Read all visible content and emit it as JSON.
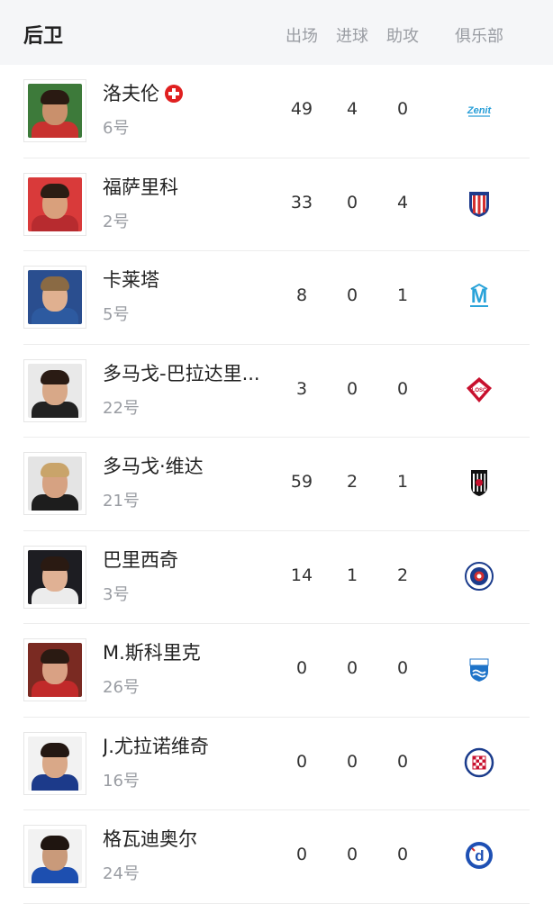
{
  "header": {
    "title": "后卫",
    "col_apps": "出场",
    "col_goals": "进球",
    "col_assists": "助攻",
    "col_club": "俱乐部"
  },
  "players": [
    {
      "name": "洛夫伦",
      "number": "6号",
      "apps": "49",
      "goals": "4",
      "assists": "0",
      "club_icon": "zenit-logo",
      "flag": "switzerland-flag-icon",
      "bg": "#3d7a3a",
      "skin": "#c9906c",
      "hair": "#2a1a12",
      "shirt": "#c8322f"
    },
    {
      "name": "福萨里科",
      "number": "2号",
      "apps": "33",
      "goals": "0",
      "assists": "4",
      "club_icon": "atletico-madrid-logo",
      "bg": "#d93a3a",
      "skin": "#d9a07c",
      "hair": "#2b1d14",
      "shirt": "#b72b2f"
    },
    {
      "name": "卡莱塔",
      "number": "5号",
      "apps": "8",
      "goals": "0",
      "assists": "1",
      "club_icon": "marseille-logo",
      "bg": "#2a4e8f",
      "skin": "#e0b090",
      "hair": "#8a6a44",
      "shirt": "#2d5aa0"
    },
    {
      "name": "多马戈-巴拉达里...",
      "number": "22号",
      "apps": "3",
      "goals": "0",
      "assists": "0",
      "club_icon": "lille-logo",
      "bg": "#e9e9e9",
      "skin": "#d8a888",
      "hair": "#2a1b14",
      "shirt": "#222222"
    },
    {
      "name": "多马戈·维达",
      "number": "21号",
      "apps": "59",
      "goals": "2",
      "assists": "1",
      "club_icon": "besiktas-logo",
      "bg": "#e4e4e4",
      "skin": "#d6a282",
      "hair": "#c9a46a",
      "shirt": "#1d1d1d"
    },
    {
      "name": "巴里西奇",
      "number": "3号",
      "apps": "14",
      "goals": "1",
      "assists": "2",
      "club_icon": "rangers-logo",
      "bg": "#1d1d22",
      "skin": "#e0b194",
      "hair": "#2a1a12",
      "shirt": "#ececec"
    },
    {
      "name": "M.斯科里克",
      "number": "26号",
      "apps": "0",
      "goals": "0",
      "assists": "0",
      "club_icon": "osijek-logo",
      "bg": "#7a2a22",
      "skin": "#d9a184",
      "hair": "#2a1a12",
      "shirt": "#c12a2a"
    },
    {
      "name": "J.尤拉诺维奇",
      "number": "16号",
      "apps": "0",
      "goals": "0",
      "assists": "0",
      "club_icon": "hajduk-split-logo",
      "bg": "#f2f2f2",
      "skin": "#d9a888",
      "hair": "#231712",
      "shirt": "#1c3a8a"
    },
    {
      "name": "格瓦迪奥尔",
      "number": "24号",
      "apps": "0",
      "goals": "0",
      "assists": "0",
      "club_icon": "dinamo-zagreb-logo",
      "bg": "#f2f2f2",
      "skin": "#c99a7a",
      "hair": "#1f1510",
      "shirt": "#1d4fb0"
    }
  ]
}
